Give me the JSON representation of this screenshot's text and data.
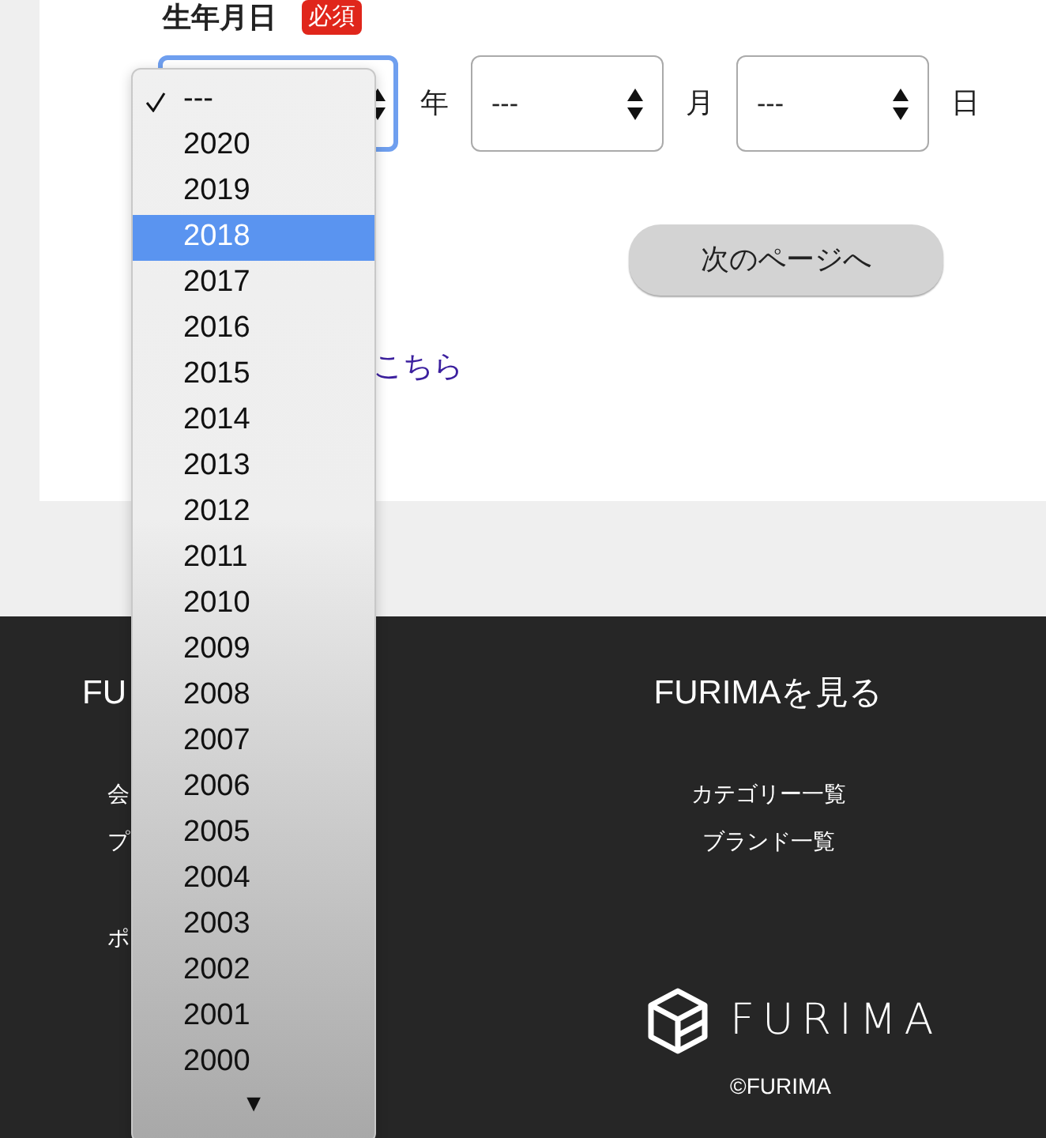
{
  "form": {
    "label": "生年月日",
    "required_badge": "必須",
    "selects": [
      {
        "unit": "年",
        "focused": true
      },
      {
        "value": "---",
        "unit": "月",
        "focused": false
      },
      {
        "value": "---",
        "unit": "日",
        "focused": false
      }
    ],
    "next_button": "次のページへ",
    "link": "こちら"
  },
  "footer": {
    "columns": [
      {
        "title": "FU",
        "link_groups": [
          [
            "会",
            "プ"
          ],
          [
            "ポ"
          ]
        ]
      },
      {
        "title": "FURIMAを見る",
        "link_groups": [
          [
            "カテゴリー一覧",
            "ブランド一覧"
          ]
        ]
      }
    ],
    "logo_text": "FURIMA",
    "copyright": "©FURIMA"
  },
  "dropdown": {
    "options": [
      {
        "label": "---",
        "checked": true,
        "selected": false
      },
      {
        "label": "2020",
        "checked": false,
        "selected": false
      },
      {
        "label": "2019",
        "checked": false,
        "selected": false
      },
      {
        "label": "2018",
        "checked": false,
        "selected": true
      },
      {
        "label": "2017",
        "checked": false,
        "selected": false
      },
      {
        "label": "2016",
        "checked": false,
        "selected": false
      },
      {
        "label": "2015",
        "checked": false,
        "selected": false
      },
      {
        "label": "2014",
        "checked": false,
        "selected": false
      },
      {
        "label": "2013",
        "checked": false,
        "selected": false
      },
      {
        "label": "2012",
        "checked": false,
        "selected": false
      },
      {
        "label": "2011",
        "checked": false,
        "selected": false
      },
      {
        "label": "2010",
        "checked": false,
        "selected": false
      },
      {
        "label": "2009",
        "checked": false,
        "selected": false
      },
      {
        "label": "2008",
        "checked": false,
        "selected": false
      },
      {
        "label": "2007",
        "checked": false,
        "selected": false
      },
      {
        "label": "2006",
        "checked": false,
        "selected": false
      },
      {
        "label": "2005",
        "checked": false,
        "selected": false
      },
      {
        "label": "2004",
        "checked": false,
        "selected": false
      },
      {
        "label": "2003",
        "checked": false,
        "selected": false
      },
      {
        "label": "2002",
        "checked": false,
        "selected": false
      },
      {
        "label": "2001",
        "checked": false,
        "selected": false
      },
      {
        "label": "2000",
        "checked": false,
        "selected": false
      }
    ],
    "scroll_arrow": "▼"
  }
}
